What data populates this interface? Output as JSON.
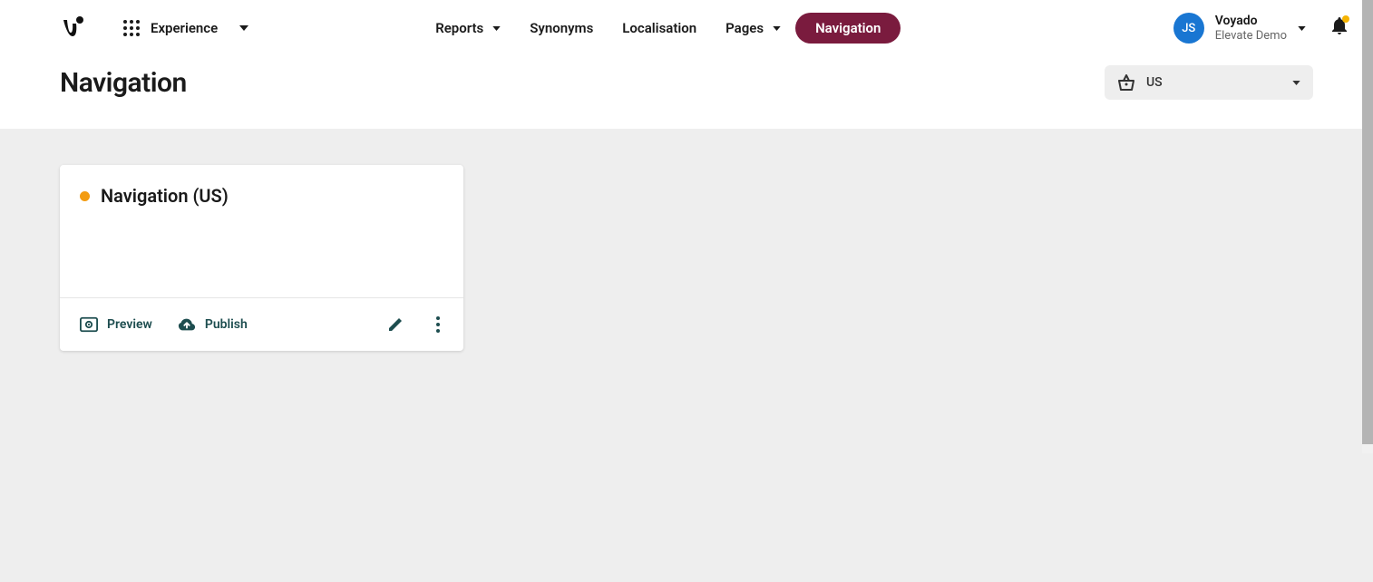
{
  "header": {
    "app_label": "Experience"
  },
  "nav": {
    "items": [
      {
        "label": "Reports",
        "has_dropdown": true
      },
      {
        "label": "Synonyms",
        "has_dropdown": false
      },
      {
        "label": "Localisation",
        "has_dropdown": false
      },
      {
        "label": "Pages",
        "has_dropdown": true
      },
      {
        "label": "Navigation",
        "has_dropdown": false,
        "active": true
      }
    ]
  },
  "user": {
    "initials": "JS",
    "name": "Voyado",
    "subtitle": "Elevate Demo"
  },
  "page": {
    "title": "Navigation"
  },
  "locale": {
    "selected": "US"
  },
  "card": {
    "title": "Navigation (US)",
    "actions": {
      "preview": "Preview",
      "publish": "Publish"
    }
  }
}
